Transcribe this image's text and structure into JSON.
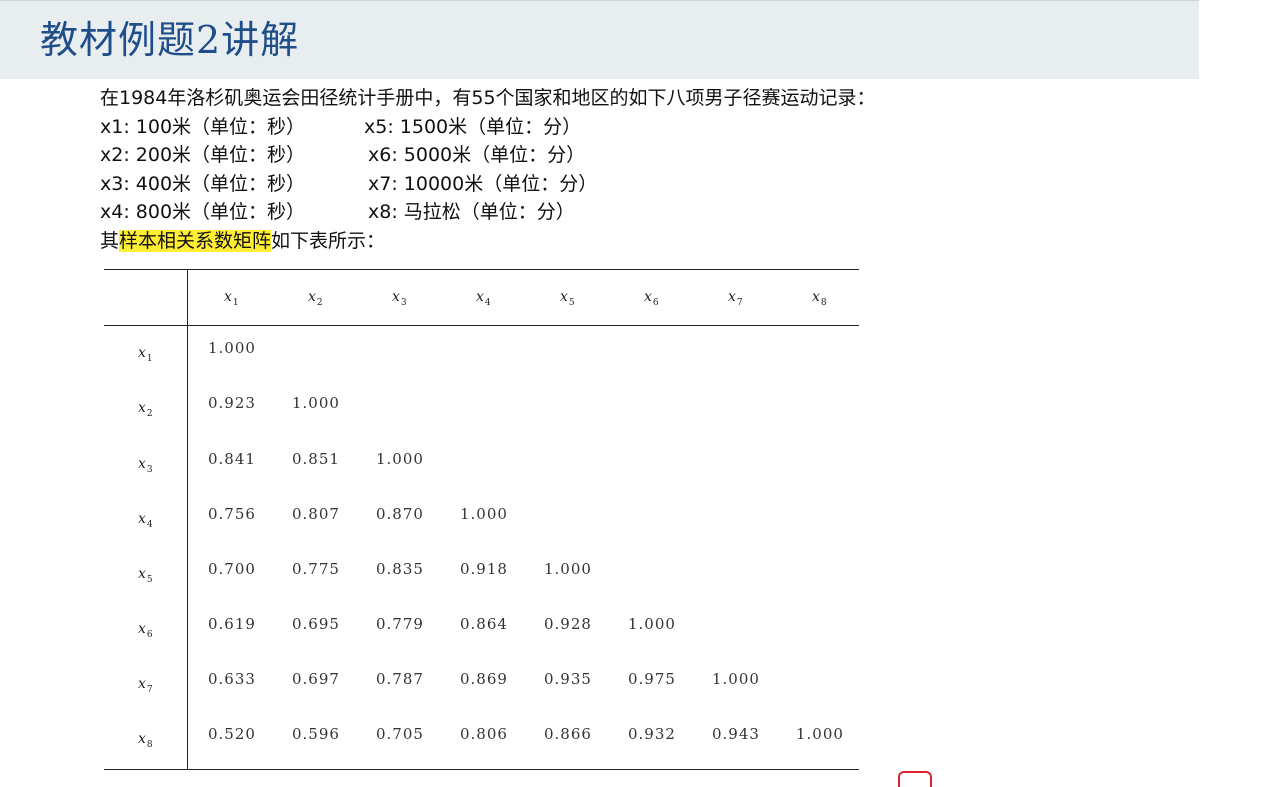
{
  "slide": {
    "title": "教材例题2讲解",
    "intro_line": "在1984年洛杉矶奥运会田径统计手册中，有55个国家和地区的如下八项男子径赛运动记录：",
    "variables": [
      {
        "left": "x1: 100米（单位：秒）",
        "right": "x5: 1500米（单位：分）"
      },
      {
        "left": "x2: 200米（单位：秒）",
        "right": "x6: 5000米（单位：分）"
      },
      {
        "left": "x3: 400米（单位：秒）",
        "right": "x7: 10000米（单位：分）"
      },
      {
        "left": "x4: 800米（单位：秒）",
        "right": "x8: 马拉松（单位：分）"
      }
    ],
    "summary_pre": "其",
    "summary_highlight": "样本相关系数矩阵",
    "summary_post": "如下表所示："
  },
  "matrix": {
    "headers": [
      "x1",
      "x2",
      "x3",
      "x4",
      "x5",
      "x6",
      "x7",
      "x8"
    ],
    "rows": [
      {
        "label": "x1",
        "values": [
          "1.000"
        ]
      },
      {
        "label": "x2",
        "values": [
          "0.923",
          "1.000"
        ]
      },
      {
        "label": "x3",
        "values": [
          "0.841",
          "0.851",
          "1.000"
        ]
      },
      {
        "label": "x4",
        "values": [
          "0.756",
          "0.807",
          "0.870",
          "1.000"
        ]
      },
      {
        "label": "x5",
        "values": [
          "0.700",
          "0.775",
          "0.835",
          "0.918",
          "1.000"
        ]
      },
      {
        "label": "x6",
        "values": [
          "0.619",
          "0.695",
          "0.779",
          "0.864",
          "0.928",
          "1.000"
        ]
      },
      {
        "label": "x7",
        "values": [
          "0.633",
          "0.697",
          "0.787",
          "0.869",
          "0.935",
          "0.975",
          "1.000"
        ]
      },
      {
        "label": "x8",
        "values": [
          "0.520",
          "0.596",
          "0.705",
          "0.806",
          "0.866",
          "0.932",
          "0.943",
          "1.000"
        ]
      }
    ]
  },
  "colors": {
    "title": "#1f4e8a",
    "title_bg": "#e8eef0",
    "highlight": "#ffee33"
  }
}
